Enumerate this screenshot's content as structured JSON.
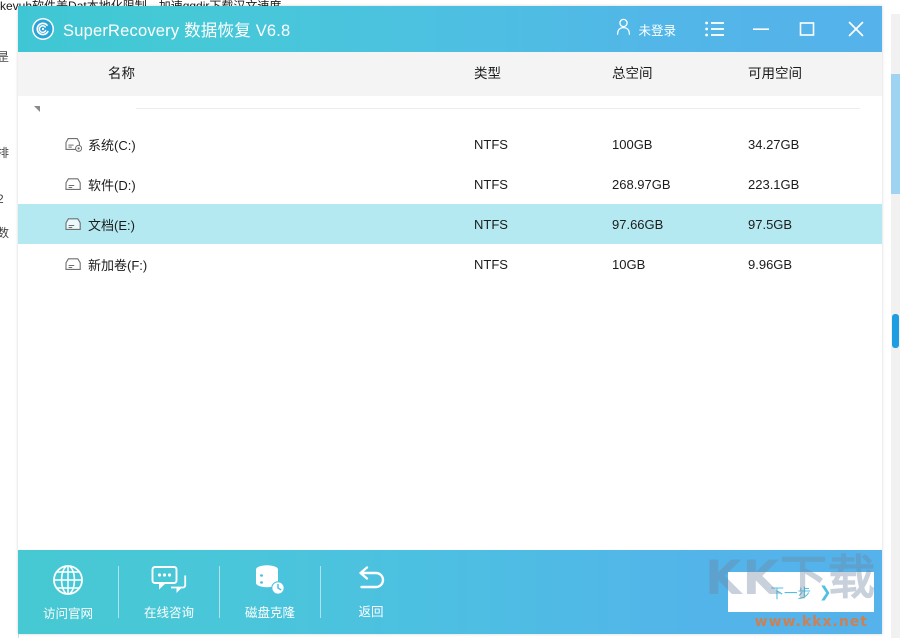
{
  "backdrop": {
    "top_text": "kevuh软件美Dat本地化限制，加速qqdir下载汉文速度",
    "left_glyphs": [
      "昰",
      "排",
      "2",
      "数"
    ]
  },
  "titlebar": {
    "logo_icon": "spiral-logo-icon",
    "title": "SuperRecovery 数据恢复 V6.8",
    "account": {
      "icon": "user-icon",
      "label": "未登录"
    },
    "menu_icon": "list-menu-icon",
    "minimize_icon": "minimize-icon",
    "maximize_icon": "maximize-icon",
    "close_icon": "close-icon",
    "gradient_from": "#3fc6d4",
    "gradient_to": "#55b2ea"
  },
  "table": {
    "headers": {
      "name": "名称",
      "type": "类型",
      "total": "总空间",
      "free": "可用空间"
    },
    "group_toggle_icon": "collapse-triangle-icon",
    "rows": [
      {
        "icon": "system-disk-icon",
        "name": "系统(C:)",
        "type": "NTFS",
        "total": "100GB",
        "free": "34.27GB",
        "selected": false
      },
      {
        "icon": "disk-icon",
        "name": "软件(D:)",
        "type": "NTFS",
        "total": "268.97GB",
        "free": "223.1GB",
        "selected": false
      },
      {
        "icon": "disk-icon",
        "name": "文档(E:)",
        "type": "NTFS",
        "total": "97.66GB",
        "free": "97.5GB",
        "selected": true
      },
      {
        "icon": "disk-icon",
        "name": "新加卷(F:)",
        "type": "NTFS",
        "total": "10GB",
        "free": "9.96GB",
        "selected": false
      }
    ],
    "selected_row_color": "#b5e9f1",
    "header_bg": "#f4f4f4"
  },
  "bottombar": {
    "tools": [
      {
        "icon": "globe-icon",
        "label": "访问官网"
      },
      {
        "icon": "chat-bubble-icon",
        "label": "在线咨询"
      },
      {
        "icon": "disk-clone-icon",
        "label": "磁盘克隆"
      },
      {
        "icon": "back-arrow-icon",
        "label": "返回"
      }
    ],
    "next_button": {
      "label": "下一步",
      "arrow": "❯",
      "text_color": "#4fc0e4"
    }
  },
  "watermark": {
    "big": "KK下载",
    "small": "www.kkx.net"
  }
}
